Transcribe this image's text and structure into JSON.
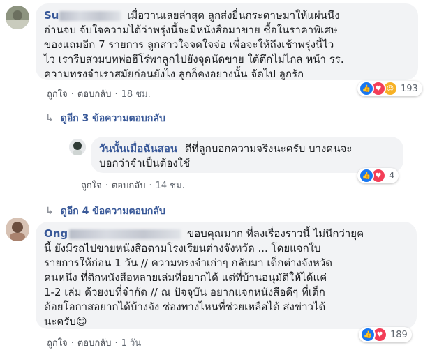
{
  "comment1": {
    "author": "Su",
    "lines": [
      "เมื่อวานเลยล่าสุด ลูกส่งยื่นกระดาษมาให้แผ่นนึง",
      "อ่านจบ จับใจความได้ว่าพรุ่งนี้จะมีหนังสือมาขาย ซื้อในราคาพิเศษ",
      "ของแถมอีก 7 รายการ ลูกสาวใจจดใจจ่อ เพื่อจะให้ถึงเช้าพรุ่งนี้ไว",
      "ไว เรารีบสวมบทพ่อฮีโร่พาลูกไปยังจุดนัดขาย ใต้ตึกไม่ไกล หน้า รร.",
      "ความทรงจำเราสมัยก่อนยังไง ลูกก็คงอย่างนั้น จัดไป ลูกรัก"
    ],
    "like": "ถูกใจ",
    "reply": "ตอบกลับ",
    "time": "18 ชม.",
    "reaction_count": "193"
  },
  "more_replies_1": "ดูอีก 3 ข้อความตอบกลับ",
  "reply1": {
    "author": "วันนั้นเมื่อฉันสอน",
    "lines": [
      "ดีที่ลูกบอกความจริงนะครับ บางคนจะ",
      "บอกว่าจำเป็นต้องใช้"
    ],
    "like": "ถูกใจ",
    "reply": "ตอบกลับ",
    "time": "14 ชม.",
    "reaction_count": "4"
  },
  "more_replies_2": "ดูอีก 4 ข้อความตอบกลับ",
  "comment2": {
    "author": "Ong",
    "lines": [
      "ขอบคุณมาก ที่ลงเรื่องราวนี้ ไม่นึกว่ายุค",
      "นี้ ยังมีรถไปขายหนังสือตามโรงเรียนต่างจังหวัด ... โดยแจกใบ",
      "รายการให้ก่อน 1 วัน // ความทรงจำเก่าๆ กลับมา เด็กต่างจังหวัด",
      "คนหนึ่ง ที่ติกหนังสือหลายเล่มที่อยากได้ แต่ที่บ้านอนุมัติให้ได้แค่",
      "1-2 เล่ม ด้วยงบที่จำกัด // ณ ปัจจุบัน อยากแจกหนังสือดีๆ ที่เด็ก",
      "ด้อยโอกาสอยากได้บ้างจัง ช่องทางไหนที่ช่วยเหลือได้ ส่งข่าวได้",
      "นะครับ"
    ],
    "emoji": "😊",
    "like": "ถูกใจ",
    "reply": "ตอบกลับ",
    "time": "1 วัน",
    "reaction_count": "189"
  },
  "colors": {
    "link": "#385898",
    "bubble": "#f2f3f5",
    "like": "#1877f2",
    "love": "#f33e58",
    "haha": "#f7b125"
  }
}
